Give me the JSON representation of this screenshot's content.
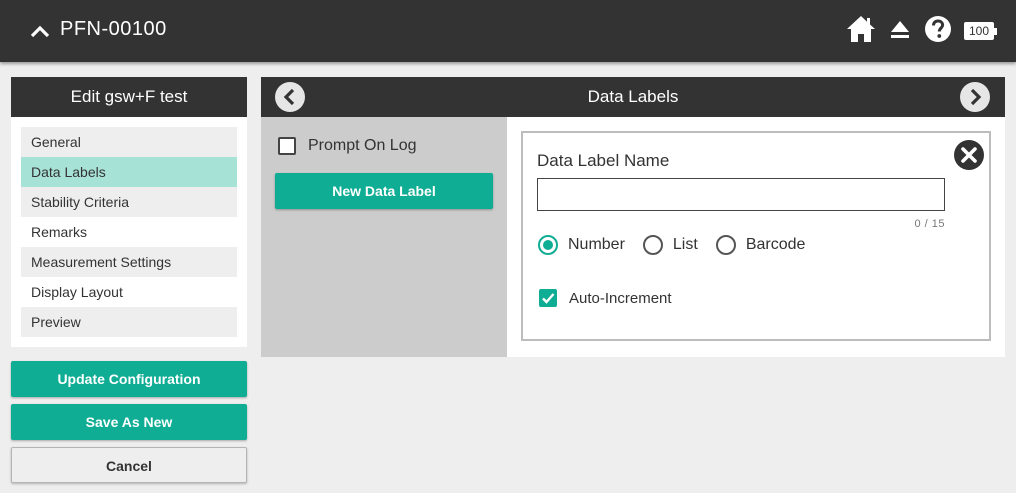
{
  "topbar": {
    "title": "PFN-00100",
    "battery_level": "100",
    "icons": [
      "chevron-up-icon",
      "home-icon",
      "eject-icon",
      "help-icon",
      "battery-icon"
    ]
  },
  "left": {
    "header": "Edit gsw+F test",
    "items": [
      {
        "label": "General"
      },
      {
        "label": "Data Labels"
      },
      {
        "label": "Stability Criteria"
      },
      {
        "label": "Remarks"
      },
      {
        "label": "Measurement Settings"
      },
      {
        "label": "Display Layout"
      },
      {
        "label": "Preview"
      }
    ],
    "active_item": "Data Labels",
    "update_label": "Update Configuration",
    "save_new_label": "Save As New",
    "cancel_label": "Cancel"
  },
  "right": {
    "header": "Data Labels",
    "prompt_on_log_label": "Prompt On Log",
    "prompt_on_log_checked": false,
    "new_label_button": "New Data Label",
    "card": {
      "name_label": "Data Label Name",
      "name_value": "",
      "char_count": "0 / 15",
      "radio_options": [
        {
          "label": "Number",
          "selected": true
        },
        {
          "label": "List",
          "selected": false
        },
        {
          "label": "Barcode",
          "selected": false
        }
      ],
      "auto_increment_label": "Auto-Increment",
      "auto_increment_checked": true
    }
  },
  "colors": {
    "accent": "#10ad95",
    "active_item": "#a7e2d7",
    "dark": "#333333"
  }
}
